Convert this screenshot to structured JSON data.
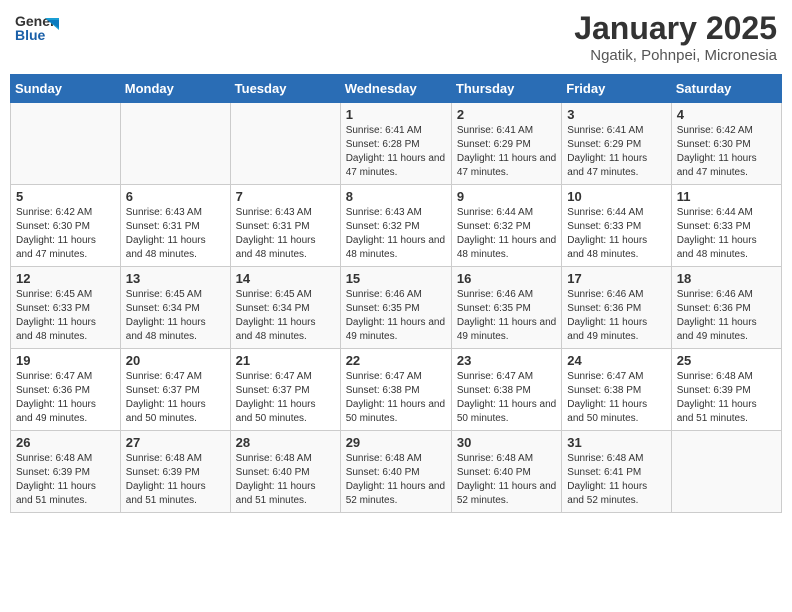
{
  "header": {
    "logo_general": "General",
    "logo_blue": "Blue",
    "month_title": "January 2025",
    "location": "Ngatik, Pohnpei, Micronesia"
  },
  "days_of_week": [
    "Sunday",
    "Monday",
    "Tuesday",
    "Wednesday",
    "Thursday",
    "Friday",
    "Saturday"
  ],
  "weeks": [
    [
      {
        "day": "",
        "content": ""
      },
      {
        "day": "",
        "content": ""
      },
      {
        "day": "",
        "content": ""
      },
      {
        "day": "1",
        "content": "Sunrise: 6:41 AM\nSunset: 6:28 PM\nDaylight: 11 hours and 47 minutes."
      },
      {
        "day": "2",
        "content": "Sunrise: 6:41 AM\nSunset: 6:29 PM\nDaylight: 11 hours and 47 minutes."
      },
      {
        "day": "3",
        "content": "Sunrise: 6:41 AM\nSunset: 6:29 PM\nDaylight: 11 hours and 47 minutes."
      },
      {
        "day": "4",
        "content": "Sunrise: 6:42 AM\nSunset: 6:30 PM\nDaylight: 11 hours and 47 minutes."
      }
    ],
    [
      {
        "day": "5",
        "content": "Sunrise: 6:42 AM\nSunset: 6:30 PM\nDaylight: 11 hours and 47 minutes."
      },
      {
        "day": "6",
        "content": "Sunrise: 6:43 AM\nSunset: 6:31 PM\nDaylight: 11 hours and 48 minutes."
      },
      {
        "day": "7",
        "content": "Sunrise: 6:43 AM\nSunset: 6:31 PM\nDaylight: 11 hours and 48 minutes."
      },
      {
        "day": "8",
        "content": "Sunrise: 6:43 AM\nSunset: 6:32 PM\nDaylight: 11 hours and 48 minutes."
      },
      {
        "day": "9",
        "content": "Sunrise: 6:44 AM\nSunset: 6:32 PM\nDaylight: 11 hours and 48 minutes."
      },
      {
        "day": "10",
        "content": "Sunrise: 6:44 AM\nSunset: 6:33 PM\nDaylight: 11 hours and 48 minutes."
      },
      {
        "day": "11",
        "content": "Sunrise: 6:44 AM\nSunset: 6:33 PM\nDaylight: 11 hours and 48 minutes."
      }
    ],
    [
      {
        "day": "12",
        "content": "Sunrise: 6:45 AM\nSunset: 6:33 PM\nDaylight: 11 hours and 48 minutes."
      },
      {
        "day": "13",
        "content": "Sunrise: 6:45 AM\nSunset: 6:34 PM\nDaylight: 11 hours and 48 minutes."
      },
      {
        "day": "14",
        "content": "Sunrise: 6:45 AM\nSunset: 6:34 PM\nDaylight: 11 hours and 48 minutes."
      },
      {
        "day": "15",
        "content": "Sunrise: 6:46 AM\nSunset: 6:35 PM\nDaylight: 11 hours and 49 minutes."
      },
      {
        "day": "16",
        "content": "Sunrise: 6:46 AM\nSunset: 6:35 PM\nDaylight: 11 hours and 49 minutes."
      },
      {
        "day": "17",
        "content": "Sunrise: 6:46 AM\nSunset: 6:36 PM\nDaylight: 11 hours and 49 minutes."
      },
      {
        "day": "18",
        "content": "Sunrise: 6:46 AM\nSunset: 6:36 PM\nDaylight: 11 hours and 49 minutes."
      }
    ],
    [
      {
        "day": "19",
        "content": "Sunrise: 6:47 AM\nSunset: 6:36 PM\nDaylight: 11 hours and 49 minutes."
      },
      {
        "day": "20",
        "content": "Sunrise: 6:47 AM\nSunset: 6:37 PM\nDaylight: 11 hours and 50 minutes."
      },
      {
        "day": "21",
        "content": "Sunrise: 6:47 AM\nSunset: 6:37 PM\nDaylight: 11 hours and 50 minutes."
      },
      {
        "day": "22",
        "content": "Sunrise: 6:47 AM\nSunset: 6:38 PM\nDaylight: 11 hours and 50 minutes."
      },
      {
        "day": "23",
        "content": "Sunrise: 6:47 AM\nSunset: 6:38 PM\nDaylight: 11 hours and 50 minutes."
      },
      {
        "day": "24",
        "content": "Sunrise: 6:47 AM\nSunset: 6:38 PM\nDaylight: 11 hours and 50 minutes."
      },
      {
        "day": "25",
        "content": "Sunrise: 6:48 AM\nSunset: 6:39 PM\nDaylight: 11 hours and 51 minutes."
      }
    ],
    [
      {
        "day": "26",
        "content": "Sunrise: 6:48 AM\nSunset: 6:39 PM\nDaylight: 11 hours and 51 minutes."
      },
      {
        "day": "27",
        "content": "Sunrise: 6:48 AM\nSunset: 6:39 PM\nDaylight: 11 hours and 51 minutes."
      },
      {
        "day": "28",
        "content": "Sunrise: 6:48 AM\nSunset: 6:40 PM\nDaylight: 11 hours and 51 minutes."
      },
      {
        "day": "29",
        "content": "Sunrise: 6:48 AM\nSunset: 6:40 PM\nDaylight: 11 hours and 52 minutes."
      },
      {
        "day": "30",
        "content": "Sunrise: 6:48 AM\nSunset: 6:40 PM\nDaylight: 11 hours and 52 minutes."
      },
      {
        "day": "31",
        "content": "Sunrise: 6:48 AM\nSunset: 6:41 PM\nDaylight: 11 hours and 52 minutes."
      },
      {
        "day": "",
        "content": ""
      }
    ]
  ]
}
